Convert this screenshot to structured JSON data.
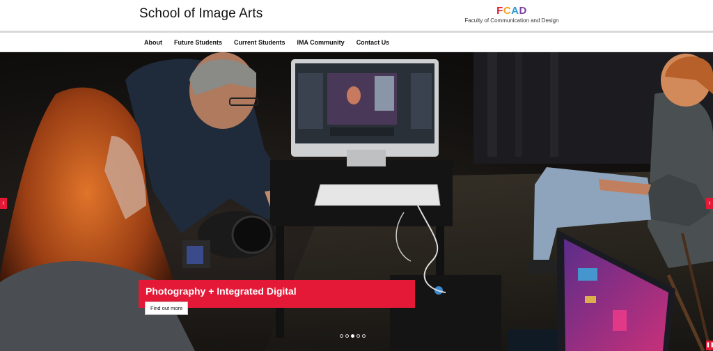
{
  "header": {
    "site_title": "School of Image Arts",
    "logo_text": "FCAD",
    "logo_subtitle": "Faculty of Communication and Design"
  },
  "nav": {
    "items": [
      "About",
      "Future Students",
      "Current Students",
      "IMA Community",
      "Contact Us"
    ]
  },
  "hero": {
    "caption_title": "Photography + Integrated Digital",
    "cta_label": "Find out more",
    "slide_count": 5,
    "active_slide": 3,
    "prev_icon": "chevron-left-icon",
    "next_icon": "chevron-right-icon",
    "pause_icon": "pause-icon"
  },
  "colors": {
    "accent": "#e31937",
    "logo_f": "#e31937",
    "logo_c": "#f7a21b",
    "logo_a": "#2e9bd6",
    "logo_d": "#7b3fa0"
  }
}
